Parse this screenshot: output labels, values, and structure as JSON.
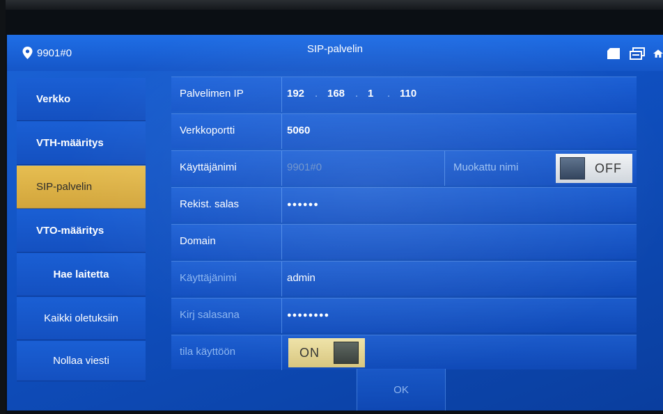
{
  "header": {
    "device_id": "9901#0",
    "title": "SIP-palvelin"
  },
  "sidebar": {
    "items": [
      {
        "label": "Verkko"
      },
      {
        "label": "VTH-määritys"
      },
      {
        "label": "SIP-palvelin",
        "active": true
      },
      {
        "label": "VTO-määritys"
      },
      {
        "label": "Hae laitetta"
      },
      {
        "label": "Kaikki oletuksiin"
      },
      {
        "label": "Nollaa viesti"
      }
    ]
  },
  "form": {
    "server_ip": {
      "label": "Palvelimen IP",
      "octets": [
        "192",
        "168",
        "1",
        "110"
      ],
      "separator": "."
    },
    "port": {
      "label": "Verkkoportti",
      "value": "5060"
    },
    "username": {
      "label": "Käyttäjänimi",
      "value": "9901#0"
    },
    "custom_name": {
      "label": "Muokattu nimi",
      "state": "OFF"
    },
    "reg_password": {
      "label": "Rekist. salas",
      "value": "●●●●●●"
    },
    "domain": {
      "label": "Domain",
      "value": ""
    },
    "login_username": {
      "label": "Käyttäjänimi",
      "value": "admin"
    },
    "login_password": {
      "label": "Kirj salasana",
      "value": "●●●●●●●●"
    },
    "enable": {
      "label": "tila käyttöön",
      "state": "ON"
    }
  },
  "footer": {
    "ok_label": "OK"
  },
  "colors": {
    "accent": "#1556c8",
    "active_tab": "#d9ad45"
  },
  "icons": [
    "location-pin-icon",
    "sd-card-icon",
    "network-icon",
    "home-icon"
  ]
}
